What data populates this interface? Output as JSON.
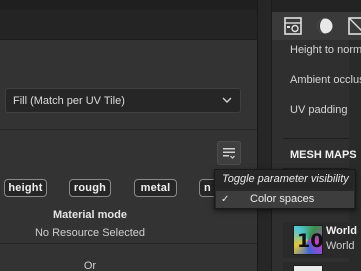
{
  "left": {
    "fill_dropdown": {
      "value": "Fill (Match per UV Tile)"
    },
    "channels": [
      {
        "label": "height"
      },
      {
        "label": "rough"
      },
      {
        "label": "metal"
      },
      {
        "label": "n"
      }
    ],
    "material_mode": {
      "title": "Material mode",
      "value": "No Resource Selected"
    },
    "or_label": "Or"
  },
  "menu": {
    "title": "Toggle parameter visibility",
    "items": [
      {
        "label": "Color spaces",
        "checked": true,
        "check_glyph": "✓"
      }
    ]
  },
  "right": {
    "tabs": [
      {
        "icon": "texture-set-settings-icon"
      },
      {
        "icon": "environment-sphere-icon"
      },
      {
        "icon": "display-settings-icon"
      }
    ],
    "settings": [
      {
        "label": "Height to normal"
      },
      {
        "label": "Ambient occlusion"
      },
      {
        "label": "UV padding"
      }
    ],
    "mesh_maps": {
      "header": "MESH MAPS",
      "items": [
        {
          "name": "World",
          "subtitle": "World",
          "thumb_text": "10"
        },
        {
          "name": "",
          "subtitle": ""
        }
      ]
    }
  },
  "colors": {
    "panel_bg": "#333333",
    "menu_bg": "#272727",
    "menu_highlight": "#3d3d3d",
    "pill_border": "#8a8a8a"
  }
}
